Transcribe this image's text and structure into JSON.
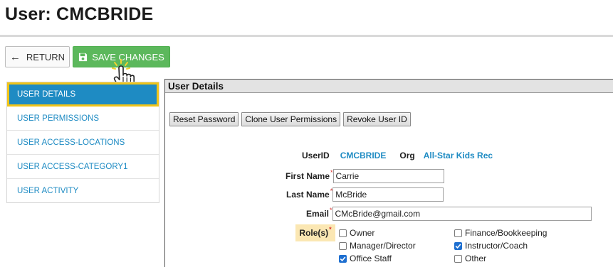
{
  "page": {
    "title": "User: CMCBRIDE"
  },
  "toolbar": {
    "return_label": "RETURN",
    "save_label": "SAVE CHANGES"
  },
  "sidebar": {
    "items": [
      {
        "label": "USER DETAILS",
        "active": true
      },
      {
        "label": "USER PERMISSIONS"
      },
      {
        "label": "USER ACCESS-LOCATIONS"
      },
      {
        "label": "USER ACCESS-CATEGORY1"
      },
      {
        "label": "USER ACTIVITY"
      }
    ]
  },
  "panel": {
    "title": "User Details",
    "actions": [
      "Reset Password",
      "Clone User Permissions",
      "Revoke User ID"
    ],
    "userid_label": "UserID",
    "userid_value": "CMCBRIDE",
    "org_label": "Org",
    "org_value": "All-Star Kids Rec",
    "first_name_label": "First Name",
    "first_name_value": "Carrie",
    "last_name_label": "Last Name",
    "last_name_value": "McBride",
    "email_label": "Email",
    "email_value": "CMcBride@gmail.com",
    "roles_label": "Role(s)",
    "required_mark": "*",
    "roles": [
      {
        "label": "Owner",
        "checked": false
      },
      {
        "label": "Finance/Bookkeeping",
        "checked": false
      },
      {
        "label": "Manager/Director",
        "checked": false
      },
      {
        "label": "Instructor/Coach",
        "checked": true
      },
      {
        "label": "Office Staff",
        "checked": true
      },
      {
        "label": "Other",
        "checked": false
      }
    ]
  },
  "colors": {
    "accent_blue": "#1e8bc3",
    "save_green": "#5cb85c",
    "active_border": "#f0c419",
    "required_red": "#d9302c",
    "roles_highlight": "#fbe7b3"
  },
  "icons": {
    "return": "arrow-left-icon",
    "save": "floppy-disk-icon",
    "cursor": "hand-pointer-icon"
  }
}
